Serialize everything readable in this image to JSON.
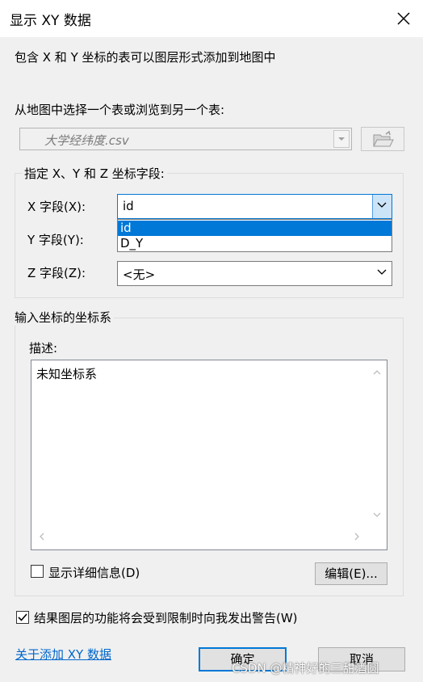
{
  "window": {
    "title": "显示 XY 数据",
    "close_icon": "close-icon"
  },
  "description": "包含 X 和 Y 坐标的表可以图层形式添加到地图中",
  "table_select": {
    "label": "从地图中选择一个表或浏览到另一个表:",
    "value": "大学经纬度.csv",
    "browse_icon": "folder-open-icon"
  },
  "fields_group": {
    "legend": "指定 X、Y 和 Z 坐标字段:",
    "x": {
      "label": "X 字段(X):",
      "value": "id"
    },
    "y": {
      "label": "Y 字段(Y):"
    },
    "z": {
      "label": "Z 字段(Z):",
      "value": "<无>"
    },
    "dropdown_options": [
      "id",
      "D_Y"
    ],
    "dropdown_selected": "id"
  },
  "coord_group": {
    "legend": "输入坐标的坐标系",
    "desc_label": "描述:",
    "desc_text": "未知坐标系",
    "show_details_label": "显示详细信息(D)",
    "show_details_checked": false,
    "edit_button": "编辑(E)..."
  },
  "warn_checkbox": {
    "label": "结果图层的功能将会受到限制时向我发出警告(W)",
    "checked": true
  },
  "help_link": "关于添加 XY 数据",
  "ok_button": "确定",
  "cancel_button": "取消",
  "watermark": "CSDN @精神好的三甜酒圆",
  "colors": {
    "accent": "#0078d7",
    "link": "#0066cc",
    "dialog_bg": "#f0f0f0"
  }
}
